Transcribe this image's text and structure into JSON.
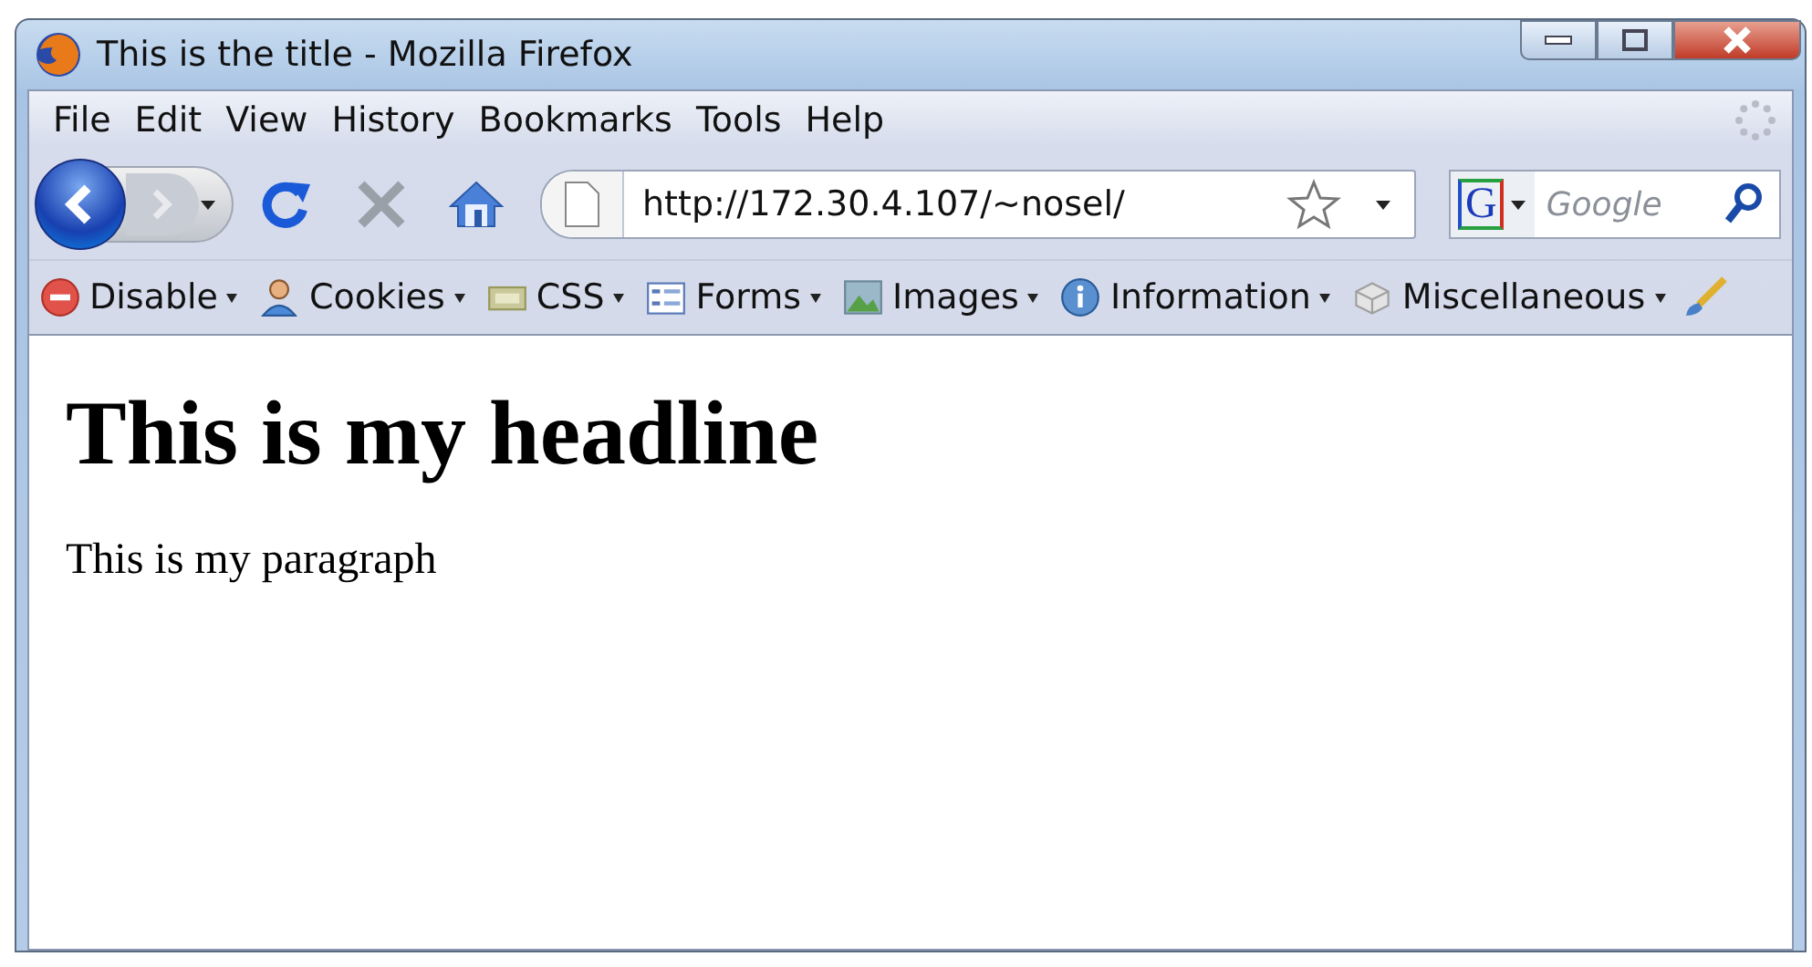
{
  "window": {
    "title": "This is the title - Mozilla Firefox"
  },
  "menu": [
    "File",
    "Edit",
    "View",
    "History",
    "Bookmarks",
    "Tools",
    "Help"
  ],
  "address": {
    "value": "http://172.30.4.107/~nosel/"
  },
  "search": {
    "engine_letter": "G",
    "placeholder": "Google"
  },
  "toolbar": [
    {
      "label": "Disable",
      "kind": "disable"
    },
    {
      "label": "Cookies",
      "kind": "cookies"
    },
    {
      "label": "CSS",
      "kind": "css"
    },
    {
      "label": "Forms",
      "kind": "forms"
    },
    {
      "label": "Images",
      "kind": "images"
    },
    {
      "label": "Information",
      "kind": "information"
    },
    {
      "label": "Miscellaneous",
      "kind": "miscellaneous"
    }
  ],
  "page": {
    "headline": "This is my headline",
    "paragraph": "This is my paragraph"
  }
}
